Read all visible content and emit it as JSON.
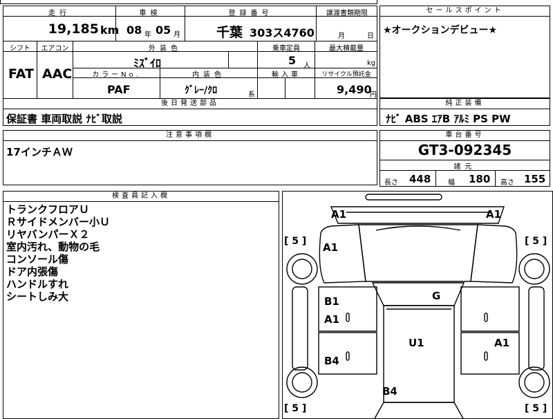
{
  "top_partial": {
    "text": "…"
  },
  "header": {
    "mileage_label": "走行",
    "inspection_label": "車検",
    "registration_label": "登録番号",
    "transfer_deadline_label": "譲渡書類期限",
    "sales_point_label": "セールスポイント"
  },
  "row1": {
    "mileage_value": "19,185",
    "mileage_unit": "km",
    "inspection_year": "08",
    "inspection_year_unit": "年",
    "inspection_month": "05",
    "inspection_month_unit": "月",
    "plate_region": "千葉",
    "plate_number": "303ス4760",
    "deadline_month_unit": "月",
    "deadline_day_unit": "日"
  },
  "sales_point": {
    "text": "★オークションデビュー★"
  },
  "spec_labels": {
    "shift": "シフト",
    "aircon": "エアコン",
    "exterior_color": "外装色",
    "capacity": "乗車定員",
    "max_load": "最大積載量",
    "color_no": "カラーNo.",
    "interior_color": "内装色",
    "import": "輸入車",
    "recycle": "リサイクル預託金"
  },
  "spec": {
    "shift": "FAT",
    "aircon": "AAC",
    "exterior_color": "ﾐｽﾞｲﾛ",
    "capacity": "5",
    "capacity_unit": "人",
    "max_load_unit": "kg",
    "color_no": "PAF",
    "interior_color": "ｸﾞﾚｰ/ｸﾛ",
    "interior_suffix": "系",
    "recycle": "9,490",
    "recycle_unit": "円"
  },
  "later_parts": {
    "label": "後日発送部品",
    "text": "保証書 車両取説 ﾅﾋﾞ取説"
  },
  "equipment": {
    "label": "純正装備",
    "text": "ﾅﾋﾞ ABS ｴｱB ｱﾙﾐ PS PW"
  },
  "notes": {
    "label": "注意事項欄",
    "text": "17インチＡＷ"
  },
  "chassis": {
    "label": "車台番号",
    "value": "GT3-092345"
  },
  "dimensions": {
    "label": "諸元",
    "length_label": "長さ",
    "length": "448",
    "width_label": "幅",
    "width": "180",
    "height_label": "高さ",
    "height": "155"
  },
  "inspector": {
    "label": "検査員記入欄",
    "items": [
      "トランクフロアＵ",
      "Ｒサイドメンバー小Ｕ",
      "リヤバンパーＸ２",
      "室内汚れ、動物の毛",
      "コンソール傷",
      "ドア内張傷",
      "ハンドルすれ",
      "シートしみ大"
    ]
  },
  "diagram": {
    "marks": {
      "a1_top_left": "A1",
      "a1_top_right": "A1",
      "a1_left_fender": "A1",
      "g_windshield": "G",
      "b1_left_front_door": "B1",
      "a1_left_front_door": "A1",
      "b4_left_rear_door": "B4",
      "u1_roof": "U1",
      "a1_right_rear_door": "A1",
      "b4_rear": "B4"
    },
    "tires": {
      "fl": "[ 5 ]",
      "fr": "[ 5 ]",
      "rl": "[ 5 ]",
      "rr": "[ 5 ]"
    }
  }
}
